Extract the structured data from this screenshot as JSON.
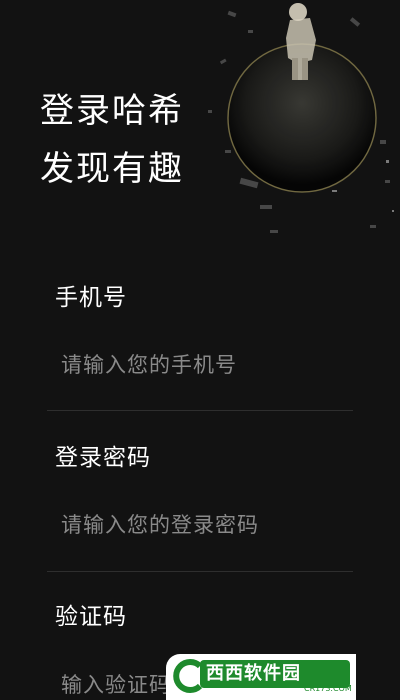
{
  "headline": {
    "line1": "登录哈希",
    "line2": "发现有趣"
  },
  "form": {
    "phone": {
      "label": "手机号",
      "placeholder": "请输入您的手机号"
    },
    "password": {
      "label": "登录密码",
      "placeholder": "请输入您的登录密码"
    },
    "code": {
      "label": "验证码",
      "placeholder": "输入验证码"
    }
  },
  "watermark": {
    "text": "西西软件园",
    "sub": "CR173.COM"
  },
  "icons": {
    "hero": "astronaut-on-planet-illustration",
    "watermark_logo": "cr173-logo-icon"
  },
  "colors": {
    "background": "#121212",
    "text": "#ffffff",
    "placeholder": "#8a8a8a",
    "divider": "#2e2e2e"
  }
}
